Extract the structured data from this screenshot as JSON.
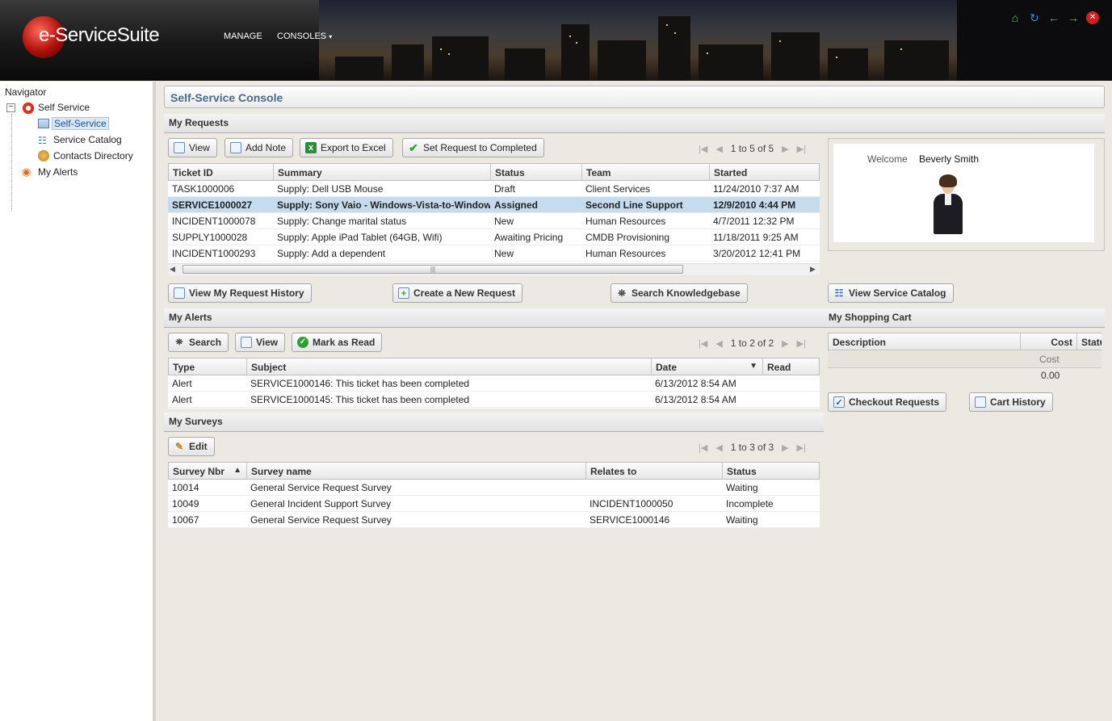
{
  "app": {
    "logo_e": "e",
    "logo_rest": "-ServiceSuite",
    "menus": [
      "MANAGE",
      "CONSOLES"
    ]
  },
  "header_icons": [
    "home-icon",
    "refresh-icon",
    "back-icon",
    "forward-icon",
    "close-icon"
  ],
  "navigator": {
    "title": "Navigator",
    "root": "Self Service",
    "children": [
      "Self-Service",
      "Service Catalog",
      "Contacts Directory"
    ],
    "alerts": "My Alerts"
  },
  "console_title": "Self-Service Console",
  "my_requests": {
    "title": "My Requests",
    "buttons": [
      "View",
      "Add Note",
      "Export to Excel",
      "Set Request to Completed"
    ],
    "pager": "1 to 5 of 5",
    "columns": [
      "Ticket ID",
      "Summary",
      "Status",
      "Team",
      "Started"
    ],
    "rows": [
      [
        "TASK1000006",
        "Supply: Dell USB Mouse",
        "Draft",
        "Client Services",
        "11/24/2010 7:37 AM"
      ],
      [
        "SERVICE1000027",
        "Supply: Sony Vaio - Windows-Vista-to-Window",
        "Assigned",
        "Second Line Support",
        "12/9/2010 4:44 PM"
      ],
      [
        "INCIDENT1000078",
        "Supply: Change marital status",
        "New",
        "Human Resources",
        "4/7/2011 12:32 PM"
      ],
      [
        "SUPPLY1000028",
        "Supply: Apple iPad Tablet (64GB, Wifi)",
        "Awaiting Pricing",
        "CMDB Provisioning",
        "11/18/2011 9:25 AM"
      ],
      [
        "INCIDENT1000293",
        "Supply: Add a dependent",
        "New",
        "Human Resources",
        "3/20/2012 12:41 PM"
      ]
    ],
    "selected_row": 1,
    "actions": [
      "View My Request History",
      "Create a New Request",
      "Search Knowledgebase"
    ]
  },
  "welcome": {
    "label": "Welcome",
    "name": "Beverly Smith"
  },
  "view_catalog": "View Service Catalog",
  "my_alerts": {
    "title": "My Alerts",
    "buttons": [
      "Search",
      "View",
      "Mark as Read"
    ],
    "pager": "1 to 2 of 2",
    "columns": [
      "Type",
      "Subject",
      "Date",
      "Read"
    ],
    "rows": [
      [
        "Alert",
        "SERVICE1000146: This ticket has been completed",
        "6/13/2012 8:54 AM",
        ""
      ],
      [
        "Alert",
        "SERVICE1000145: This ticket has been completed",
        "6/13/2012 8:54 AM",
        ""
      ]
    ]
  },
  "shopping_cart": {
    "title": "My Shopping Cart",
    "columns": [
      "Description",
      "Cost",
      "Statu"
    ],
    "summary_label": "Cost",
    "summary_value": "0.00",
    "buttons": [
      "Checkout Requests",
      "Cart History"
    ]
  },
  "my_surveys": {
    "title": "My Surveys",
    "buttons": [
      "Edit"
    ],
    "pager": "1 to 3 of 3",
    "columns": [
      "Survey Nbr",
      "Survey name",
      "Relates to",
      "Status"
    ],
    "rows": [
      [
        "10014",
        "General Service Request Survey",
        "",
        "Waiting"
      ],
      [
        "10049",
        "General Incident Support Survey",
        "INCIDENT1000050",
        "Incomplete"
      ],
      [
        "10067",
        "General Service Request Survey",
        "SERVICE1000146",
        "Waiting"
      ]
    ]
  }
}
